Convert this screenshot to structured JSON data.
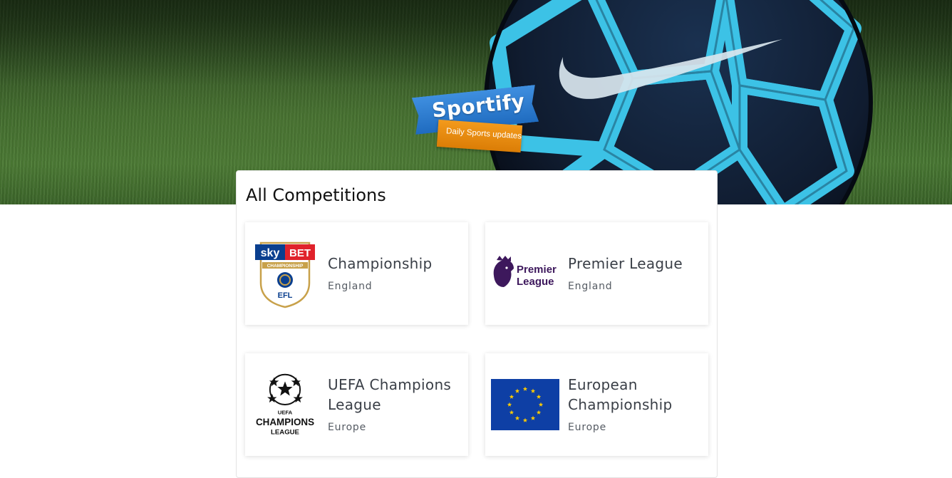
{
  "brand": {
    "name": "Sportify",
    "tagline": "Daily Sports updates"
  },
  "page": {
    "title": "All Competitions"
  },
  "competitions": [
    {
      "name": "Championship",
      "country": "England",
      "logo": {
        "icon": "sky-bet-championship-efl-logo",
        "top_left": "sky",
        "top_right": "BET",
        "ribbon": "CHAMPIONSHIP",
        "bottom": "EFL"
      }
    },
    {
      "name": "Premier League",
      "country": "England",
      "logo": {
        "icon": "premier-league-lion-logo",
        "line1": "Premier",
        "line2": "League"
      }
    },
    {
      "name": "UEFA Champions League",
      "country": "Europe",
      "logo": {
        "icon": "uefa-champions-league-starball-logo",
        "line1": "UEFA",
        "line2": "CHAMPIONS",
        "line3": "LEAGUE"
      }
    },
    {
      "name": "European Championship",
      "country": "Europe",
      "logo": {
        "icon": "eu-flag-icon"
      }
    }
  ],
  "colors": {
    "brand_blue": "#2a7bd3",
    "brand_orange": "#e8890f",
    "premier_purple": "#3d185c",
    "eu_blue": "#0e3fa5",
    "eu_star": "#ffcc00",
    "sky_red": "#e0222b",
    "sky_blue": "#003f8a",
    "efl_gold": "#c8a14a"
  }
}
